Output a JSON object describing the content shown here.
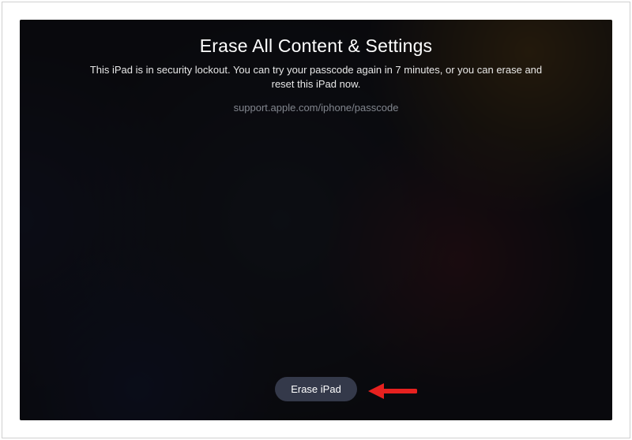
{
  "header": {
    "title": "Erase All Content & Settings",
    "subtitle": "This iPad is in security lockout. You can try your passcode again in 7 minutes, or you can erase and reset this iPad now.",
    "support_url": "support.apple.com/iphone/passcode"
  },
  "actions": {
    "erase_label": "Erase iPad"
  },
  "annotation": {
    "arrow_color": "#e7211f"
  }
}
